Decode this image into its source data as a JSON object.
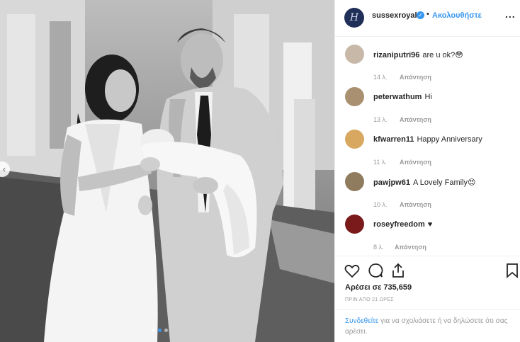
{
  "header": {
    "username": "sussexroyal",
    "separator": "•",
    "follow_label": "Ακολουθήστε",
    "more_label": "...",
    "avatar_letter": "H"
  },
  "photo": {
    "prev_arrow": "‹",
    "carousel_count": 3,
    "active_index": 1
  },
  "comments": [
    {
      "username": "rizaniputri96",
      "text": "are u ok?😳",
      "time": "14 λ.",
      "reply": "Απάντηση",
      "avatar_color": "#c8b8a8"
    },
    {
      "username": "peterwathum",
      "text": "Hi",
      "time": "13 λ.",
      "reply": "Απάντηση",
      "avatar_color": "#a89070"
    },
    {
      "username": "kfwarren11",
      "text": "Happy Anniversary",
      "time": "11 λ.",
      "reply": "Απάντηση",
      "avatar_color": "#d9a860"
    },
    {
      "username": "pawjpw61",
      "text": "A Lovely Family😍",
      "time": "10 λ.",
      "reply": "Απάντηση",
      "avatar_color": "#8f7b5e"
    },
    {
      "username": "roseyfreedom",
      "text": "♥",
      "time": "8 λ.",
      "reply": "Απάντηση",
      "avatar_color": "#7a1a1a"
    }
  ],
  "actions": {
    "likes_text": "Αρέσει σε 735,659",
    "time_ago": "ΠΡΙΝ ΑΠΟ 21 ΩΡΕΣ",
    "login_link": "Συνδεθείτε",
    "login_rest": " για να σχολιάσετε ή να δηλώσετε ότι σας αρέσει."
  },
  "colors": {
    "accent": "#3897f0",
    "text": "#262626",
    "muted": "#999999",
    "border": "#efefef"
  },
  "icons": [
    "heart-icon",
    "comment-icon",
    "share-icon",
    "bookmark-icon",
    "verified-badge-icon",
    "chevron-left-icon"
  ]
}
